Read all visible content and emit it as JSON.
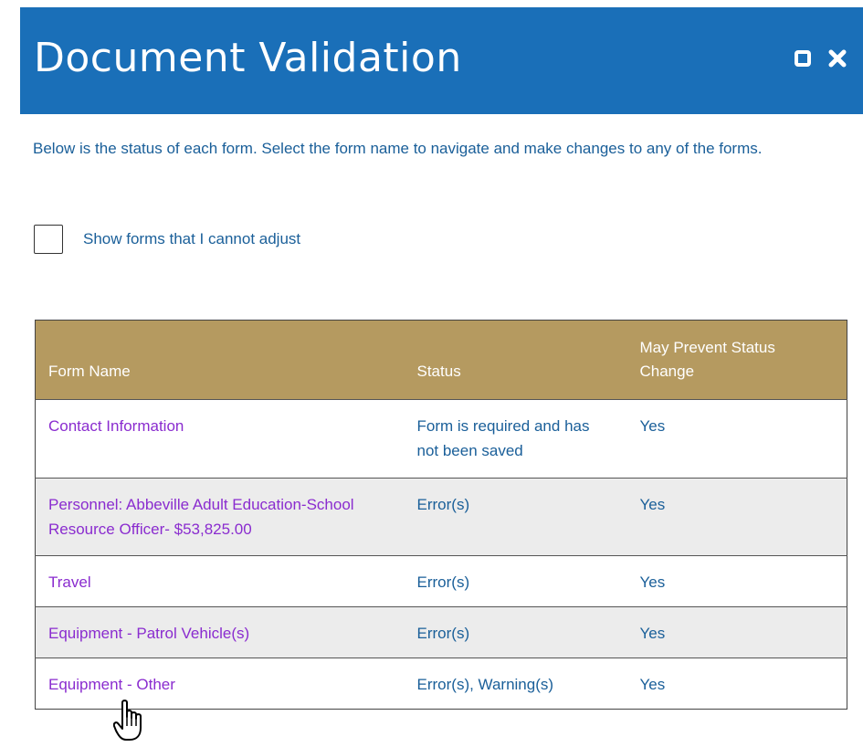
{
  "dialog": {
    "title": "Document Validation",
    "intro": "Below is the status of each form. Select the form name to navigate and make changes to any of the forms.",
    "checkbox_label": "Show forms that I cannot adjust",
    "checkbox_checked": false
  },
  "table": {
    "headers": [
      "Form Name",
      "Status",
      "May Prevent Status Change"
    ],
    "rows": [
      {
        "name": "Contact Information",
        "status": "Form is required and has not been saved",
        "prevent": "Yes"
      },
      {
        "name": "Personnel: Abbeville Adult Education-School Resource Officer- $53,825.00",
        "status": "Error(s)",
        "prevent": "Yes"
      },
      {
        "name": "Travel",
        "status": "Error(s)",
        "prevent": "Yes"
      },
      {
        "name": "Equipment - Patrol Vehicle(s)",
        "status": "Error(s)",
        "prevent": "Yes"
      },
      {
        "name": "Equipment - Other",
        "status": "Error(s), Warning(s)",
        "prevent": "Yes"
      }
    ]
  },
  "colors": {
    "titlebar": "#1a6fb8",
    "header": "#b59a60",
    "link": "#8a2ccf",
    "text": "#1a5f99"
  },
  "icons": [
    "restore-icon",
    "close-icon",
    "hand-cursor-icon"
  ]
}
